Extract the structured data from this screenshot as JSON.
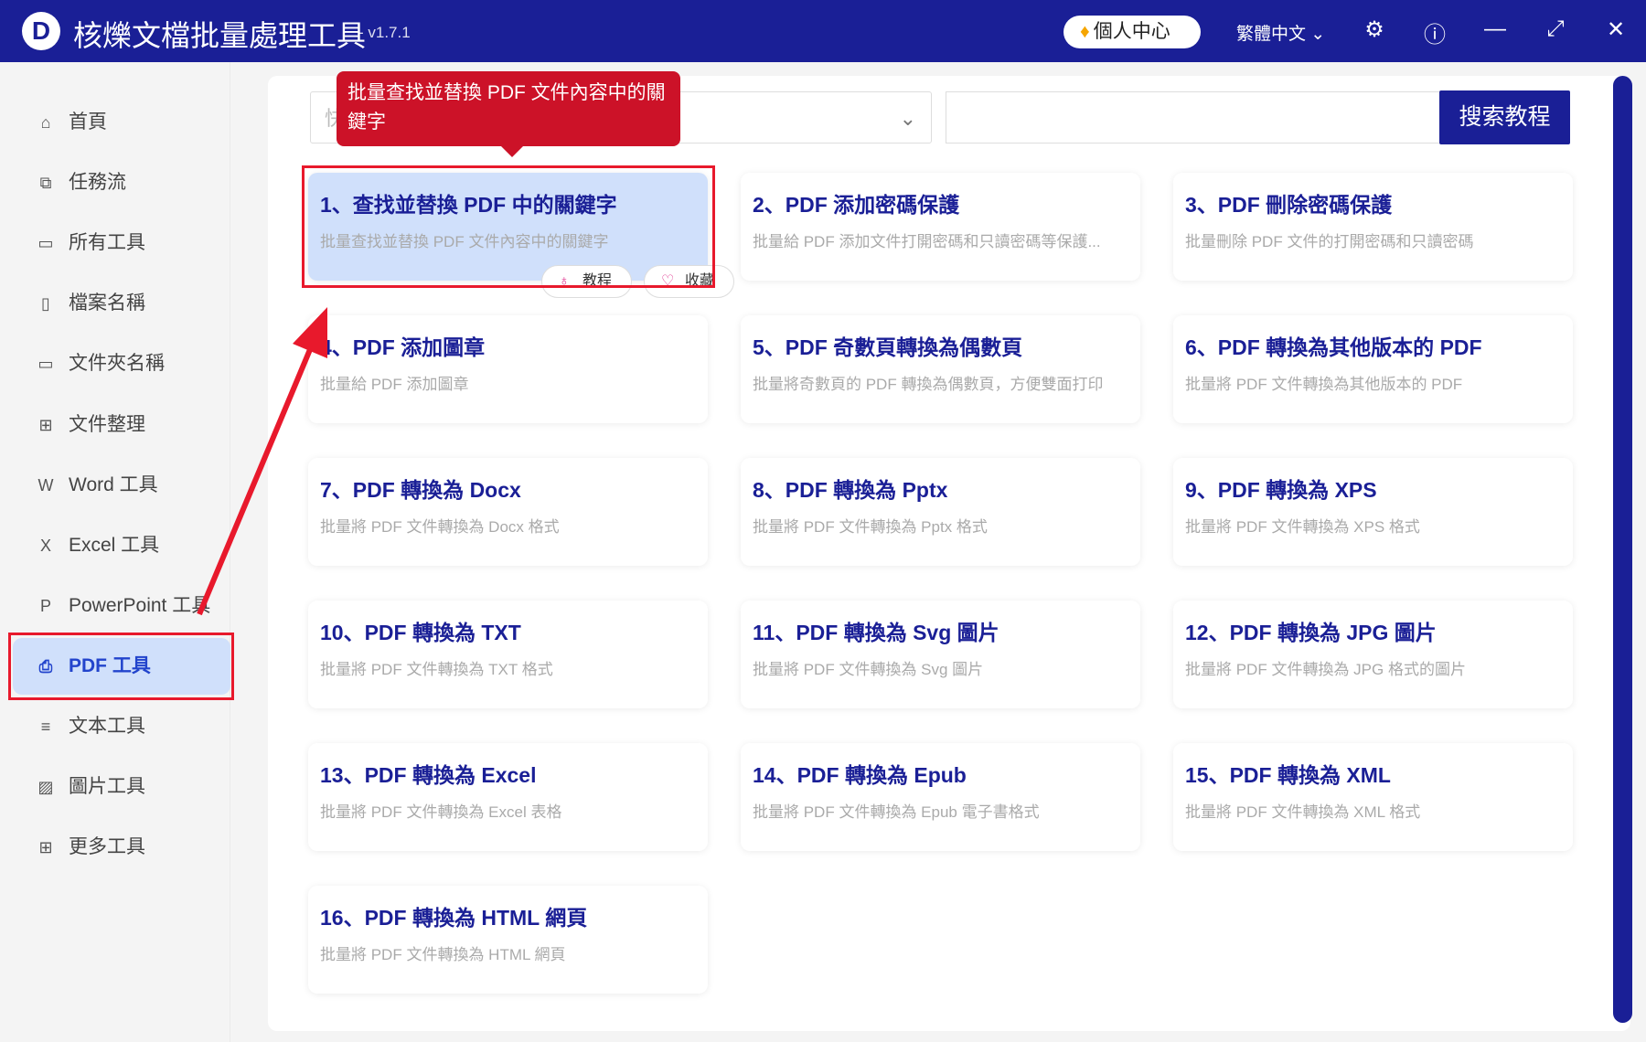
{
  "titlebar": {
    "logo": "D",
    "title": "核爍文檔批量處理工具",
    "version": "- v1.7.1",
    "personal_center": "個人中心",
    "language": "繁體中文",
    "icons": [
      "gear-icon",
      "help-icon",
      "minimize-icon",
      "maximize-icon",
      "close-icon"
    ]
  },
  "sidebar": {
    "items": [
      {
        "label": "首頁",
        "icon": "⌂"
      },
      {
        "label": "任務流",
        "icon": "⧉"
      },
      {
        "label": "所有工具",
        "icon": "▭"
      },
      {
        "label": "檔案名稱",
        "icon": "▯"
      },
      {
        "label": "文件夾名稱",
        "icon": "▭"
      },
      {
        "label": "文件整理",
        "icon": "⊞"
      },
      {
        "label": "Word 工具",
        "icon": "W"
      },
      {
        "label": "Excel 工具",
        "icon": "X"
      },
      {
        "label": "PowerPoint 工具",
        "icon": "P"
      },
      {
        "label": "PDF 工具",
        "icon": "⎙"
      },
      {
        "label": "文本工具",
        "icon": "≡"
      },
      {
        "label": "圖片工具",
        "icon": "▨"
      },
      {
        "label": "更多工具",
        "icon": "⊞"
      }
    ],
    "active": "PDF 工具"
  },
  "search": {
    "dropdown_value": "快",
    "button": "搜索教程"
  },
  "tooltip": "批量查找並替換 PDF 文件內容中的關鍵字",
  "card_actions": {
    "tutorial": "教程",
    "favorite": "收藏"
  },
  "cards": [
    {
      "title": "1、查找並替換 PDF 中的關鍵字",
      "desc": "批量查找並替換 PDF 文件內容中的關鍵字"
    },
    {
      "title": "2、PDF 添加密碼保護",
      "desc": "批量給 PDF 添加文件打開密碼和只讀密碼等保護..."
    },
    {
      "title": "3、PDF 刪除密碼保護",
      "desc": "批量刪除 PDF 文件的打開密碼和只讀密碼"
    },
    {
      "title": "4、PDF 添加圖章",
      "desc": "批量給 PDF 添加圖章"
    },
    {
      "title": "5、PDF 奇數頁轉換為偶數頁",
      "desc": "批量將奇數頁的 PDF 轉換為偶數頁，方便雙面打印"
    },
    {
      "title": "6、PDF 轉換為其他版本的 PDF",
      "desc": "批量將 PDF 文件轉換為其他版本的 PDF"
    },
    {
      "title": "7、PDF 轉換為 Docx",
      "desc": "批量將 PDF 文件轉換為 Docx 格式"
    },
    {
      "title": "8、PDF 轉換為 Pptx",
      "desc": "批量將 PDF 文件轉換為 Pptx 格式"
    },
    {
      "title": "9、PDF 轉換為 XPS",
      "desc": "批量將 PDF 文件轉換為 XPS 格式"
    },
    {
      "title": "10、PDF 轉換為 TXT",
      "desc": "批量將 PDF 文件轉換為 TXT 格式"
    },
    {
      "title": "11、PDF 轉換為 Svg 圖片",
      "desc": "批量將 PDF 文件轉換為 Svg 圖片"
    },
    {
      "title": "12、PDF 轉換為 JPG 圖片",
      "desc": "批量將 PDF 文件轉換為 JPG 格式的圖片"
    },
    {
      "title": "13、PDF 轉換為 Excel",
      "desc": "批量將 PDF 文件轉換為 Excel 表格"
    },
    {
      "title": "14、PDF 轉換為 Epub",
      "desc": "批量將 PDF 文件轉換為 Epub 電子書格式"
    },
    {
      "title": "15、PDF 轉換為 XML",
      "desc": "批量將 PDF 文件轉換為 XML 格式"
    },
    {
      "title": "16、PDF 轉換為 HTML 網頁",
      "desc": "批量將 PDF 文件轉換為 HTML 網頁"
    }
  ],
  "colors": {
    "brand": "#1a1f96",
    "highlight": "#e8192c",
    "selected": "#d0e0fb"
  }
}
